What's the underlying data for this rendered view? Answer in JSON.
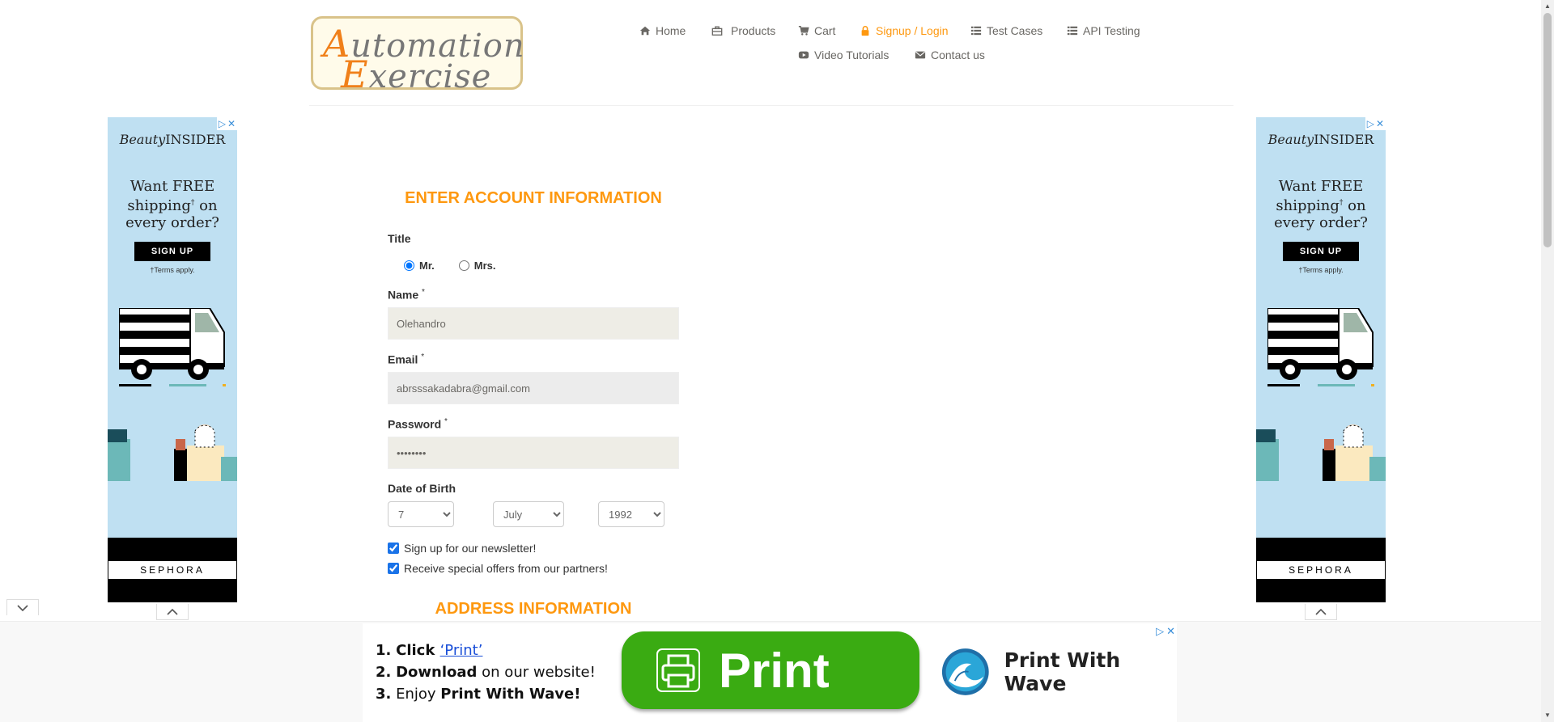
{
  "logo": {
    "line1_initial": "A",
    "line1_rest": "utomation",
    "line2_initial": "E",
    "line2_rest": "xercise"
  },
  "nav": {
    "home": "Home",
    "products": "Products",
    "cart": "Cart",
    "signup_login": "Signup / Login",
    "test_cases": "Test Cases",
    "api_testing": "API Testing",
    "video_tutorials": "Video Tutorials",
    "contact_us": "Contact us"
  },
  "side_ad": {
    "brand_italic": "Beauty",
    "brand_rest": "INSIDER",
    "pitch_line1": "Want FREE",
    "pitch_line2": "shipping",
    "pitch_mark": "†",
    "pitch_line2b": " on",
    "pitch_line3": "every order?",
    "signup": "SIGN UP",
    "terms": "†Terms apply.",
    "sephora": "SEPHORA"
  },
  "form": {
    "section_title": "ENTER ACCOUNT INFORMATION",
    "title_label": "Title",
    "title_options": [
      "Mr.",
      "Mrs."
    ],
    "title_selected": "Mr.",
    "name_label": "Name",
    "name_value": "Olehandro",
    "email_label": "Email",
    "email_value": "abrsssakadabra@gmail.com",
    "password_label": "Password",
    "password_value": "abcd1234",
    "required_mark": "*",
    "dob_label": "Date of Birth",
    "dob_day": "7",
    "dob_month": "July",
    "dob_year": "1992",
    "newsletter_label": "Sign up for our newsletter!",
    "newsletter_checked": true,
    "offers_label": "Receive special offers from our partners!",
    "offers_checked": true,
    "address_title": "ADDRESS INFORMATION"
  },
  "bottom_ad": {
    "step1_num": "1.",
    "step1_pre": "Click ",
    "step1_link": "‘Print’",
    "step2_num": "2.",
    "step2_bold": "Download",
    "step2_rest": " on our website!",
    "step3_num": "3.",
    "step3_pre": "Enjoy ",
    "step3_bold": "Print With Wave!",
    "print_button": "Print",
    "wave_brand": "Print With Wave"
  },
  "colors": {
    "accent": "#fe980f",
    "ad_blue": "#bfe0f2",
    "print_green": "#3aab12"
  }
}
